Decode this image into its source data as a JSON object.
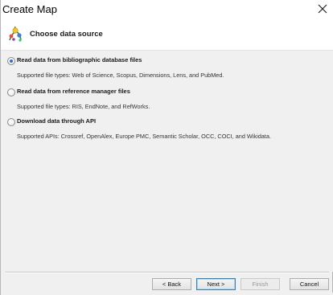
{
  "window": {
    "title": "Create Map"
  },
  "header": {
    "title": "Choose data source",
    "icon": "citespace-map-icon"
  },
  "options": [
    {
      "label": "Read data from bibliographic database files",
      "description": "Supported file types: Web of Science, Scopus, Dimensions, Lens, and PubMed.",
      "selected": true
    },
    {
      "label": "Read data from reference manager files",
      "description": "Supported file types: RIS, EndNote, and RefWorks.",
      "selected": false
    },
    {
      "label": "Download data through API",
      "description": "Supported APIs: Crossref, OpenAlex, Europe PMC, Semantic Scholar, OCC, COCI, and Wikidata.",
      "selected": false
    }
  ],
  "buttons": {
    "back": "< Back",
    "next": "Next >",
    "finish": "Finish",
    "cancel": "Cancel"
  },
  "colors": {
    "accent": "#3c7fb1",
    "radio_selected": "#3a6fb5"
  }
}
